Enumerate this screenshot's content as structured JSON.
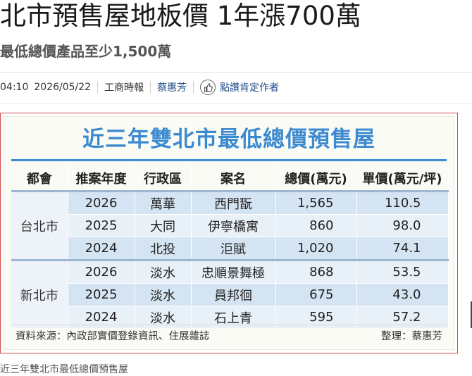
{
  "article": {
    "headline": "北市預售屋地板價 1年漲700萬",
    "subtitle": "最低總價產品至少1,500萬",
    "meta": {
      "time": "04:10",
      "date": "2026/05/22",
      "source": "工商時報",
      "author": "蔡惠芳",
      "like_label": "點讚肯定作者"
    },
    "caption": "近三年雙北市最低總價預售屋"
  },
  "figure": {
    "title": "近三年雙北市最低總價預售屋",
    "headers": [
      "都會",
      "推案年度",
      "行政區",
      "案名",
      "總價(萬元)",
      "單價(萬元/坪)"
    ],
    "groups": [
      {
        "city": "台北市",
        "rows": [
          {
            "year": "2026",
            "district": "萬華",
            "name": "西門翫",
            "total": "1,565",
            "unit": "110.5"
          },
          {
            "year": "2025",
            "district": "大同",
            "name": "伊寧橋寓",
            "total": "860",
            "unit": "98.0"
          },
          {
            "year": "2024",
            "district": "北投",
            "name": "洰賦",
            "total": "1,020",
            "unit": "74.1"
          }
        ]
      },
      {
        "city": "新北市",
        "rows": [
          {
            "year": "2026",
            "district": "淡水",
            "name": "忠順景舞極",
            "total": "868",
            "unit": "53.5"
          },
          {
            "year": "2025",
            "district": "淡水",
            "name": "員邦徊",
            "total": "675",
            "unit": "43.0"
          },
          {
            "year": "2024",
            "district": "淡水",
            "name": "石上青",
            "total": "595",
            "unit": "57.2"
          }
        ]
      }
    ],
    "source_note": "資料來源：內政部實價登錄資訊、住展雜誌",
    "editor_note": "整理：蔡惠芳",
    "colors": {
      "title": "#3c8ad0",
      "row_dark": "#d5e4f2",
      "row_light": "#e8f0f8",
      "frame": "#d24a4a"
    }
  },
  "icons": {
    "like": "thumbs-up-icon"
  }
}
